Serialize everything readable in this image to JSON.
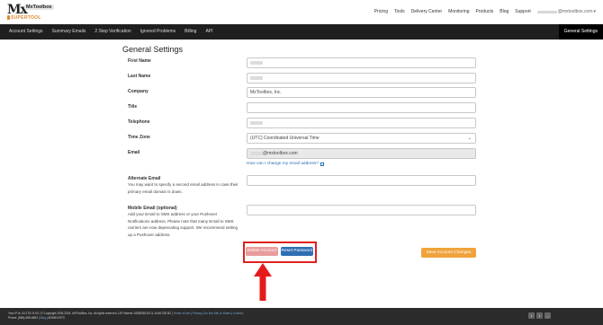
{
  "header": {
    "logo_text": "MxToolbox",
    "logo_sub": "SUPERTOOL",
    "nav": [
      "Pricing",
      "Tools",
      "Delivery Center",
      "Monitoring",
      "Products",
      "Blog",
      "Support"
    ],
    "user_email_suffix": "@mxtoolbox.com"
  },
  "mainnav": {
    "tabs": [
      "Account Settings",
      "Summary Emails",
      "2 Step Verification",
      "Ignored Problems",
      "Billing",
      "API"
    ],
    "active": "General Settings"
  },
  "page": {
    "title": "General Settings",
    "fields": {
      "first_name": {
        "label": "First Name"
      },
      "last_name": {
        "label": "Last Name"
      },
      "company": {
        "label": "Company",
        "value": "MxToolbox, Inc."
      },
      "title": {
        "label": "Title",
        "value": ""
      },
      "telephone": {
        "label": "Telephone"
      },
      "time_zone": {
        "label": "Time Zone",
        "value": "(UTC) Coordinated Universal Time"
      },
      "email": {
        "label": "Email",
        "value_suffix": "@mxtoolbox.com",
        "link": "How can I change my email address?"
      },
      "alternate_email": {
        "label": "Alternate Email",
        "description": "You may want to specify a second email address in case their primary email domain is down.",
        "value": ""
      },
      "mobile_email": {
        "label": "Mobile Email (optional)",
        "description": "Add your Email to SMS address or your Pushover Notifications address. Please note that many Email to SMS carriers are now deprecating support. We recommend setting up a Pushover address.",
        "value": ""
      }
    },
    "buttons": {
      "delete": "Delete Account",
      "reset": "Reset Password",
      "save": "Save Account Changes"
    }
  },
  "footer": {
    "line1": "Your IP is: 24.175.74.00 | © Copyright 2004-2024, MXToolBox, Inc, All rights reserved. US Patents 10839353 B2 & 11461738 B2 |",
    "line2": "Phone: (866)-698-6652 |",
    "line2_end": "| ADMIN 0973",
    "links": [
      "Terms of Use",
      "Privacy",
      "Do Not Sell or Share",
      "Cookie",
      "Blog"
    ]
  },
  "colors": {
    "nav_bg": "#1f1f1f",
    "accent_orange": "#f0a33c",
    "accent_blue": "#2f6fb3",
    "highlight_red": "#e02020"
  }
}
